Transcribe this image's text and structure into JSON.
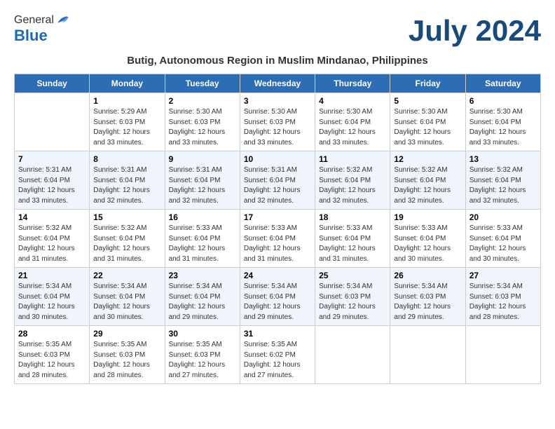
{
  "header": {
    "logo_general": "General",
    "logo_blue": "Blue",
    "month_title": "July 2024",
    "subtitle": "Butig, Autonomous Region in Muslim Mindanao, Philippines"
  },
  "calendar": {
    "weekdays": [
      "Sunday",
      "Monday",
      "Tuesday",
      "Wednesday",
      "Thursday",
      "Friday",
      "Saturday"
    ],
    "weeks": [
      [
        {
          "day": "",
          "info": ""
        },
        {
          "day": "1",
          "info": "Sunrise: 5:29 AM\nSunset: 6:03 PM\nDaylight: 12 hours\nand 33 minutes."
        },
        {
          "day": "2",
          "info": "Sunrise: 5:30 AM\nSunset: 6:03 PM\nDaylight: 12 hours\nand 33 minutes."
        },
        {
          "day": "3",
          "info": "Sunrise: 5:30 AM\nSunset: 6:03 PM\nDaylight: 12 hours\nand 33 minutes."
        },
        {
          "day": "4",
          "info": "Sunrise: 5:30 AM\nSunset: 6:04 PM\nDaylight: 12 hours\nand 33 minutes."
        },
        {
          "day": "5",
          "info": "Sunrise: 5:30 AM\nSunset: 6:04 PM\nDaylight: 12 hours\nand 33 minutes."
        },
        {
          "day": "6",
          "info": "Sunrise: 5:30 AM\nSunset: 6:04 PM\nDaylight: 12 hours\nand 33 minutes."
        }
      ],
      [
        {
          "day": "7",
          "info": "Sunrise: 5:31 AM\nSunset: 6:04 PM\nDaylight: 12 hours\nand 33 minutes."
        },
        {
          "day": "8",
          "info": "Sunrise: 5:31 AM\nSunset: 6:04 PM\nDaylight: 12 hours\nand 32 minutes."
        },
        {
          "day": "9",
          "info": "Sunrise: 5:31 AM\nSunset: 6:04 PM\nDaylight: 12 hours\nand 32 minutes."
        },
        {
          "day": "10",
          "info": "Sunrise: 5:31 AM\nSunset: 6:04 PM\nDaylight: 12 hours\nand 32 minutes."
        },
        {
          "day": "11",
          "info": "Sunrise: 5:32 AM\nSunset: 6:04 PM\nDaylight: 12 hours\nand 32 minutes."
        },
        {
          "day": "12",
          "info": "Sunrise: 5:32 AM\nSunset: 6:04 PM\nDaylight: 12 hours\nand 32 minutes."
        },
        {
          "day": "13",
          "info": "Sunrise: 5:32 AM\nSunset: 6:04 PM\nDaylight: 12 hours\nand 32 minutes."
        }
      ],
      [
        {
          "day": "14",
          "info": "Sunrise: 5:32 AM\nSunset: 6:04 PM\nDaylight: 12 hours\nand 31 minutes."
        },
        {
          "day": "15",
          "info": "Sunrise: 5:32 AM\nSunset: 6:04 PM\nDaylight: 12 hours\nand 31 minutes."
        },
        {
          "day": "16",
          "info": "Sunrise: 5:33 AM\nSunset: 6:04 PM\nDaylight: 12 hours\nand 31 minutes."
        },
        {
          "day": "17",
          "info": "Sunrise: 5:33 AM\nSunset: 6:04 PM\nDaylight: 12 hours\nand 31 minutes."
        },
        {
          "day": "18",
          "info": "Sunrise: 5:33 AM\nSunset: 6:04 PM\nDaylight: 12 hours\nand 31 minutes."
        },
        {
          "day": "19",
          "info": "Sunrise: 5:33 AM\nSunset: 6:04 PM\nDaylight: 12 hours\nand 30 minutes."
        },
        {
          "day": "20",
          "info": "Sunrise: 5:33 AM\nSunset: 6:04 PM\nDaylight: 12 hours\nand 30 minutes."
        }
      ],
      [
        {
          "day": "21",
          "info": "Sunrise: 5:34 AM\nSunset: 6:04 PM\nDaylight: 12 hours\nand 30 minutes."
        },
        {
          "day": "22",
          "info": "Sunrise: 5:34 AM\nSunset: 6:04 PM\nDaylight: 12 hours\nand 30 minutes."
        },
        {
          "day": "23",
          "info": "Sunrise: 5:34 AM\nSunset: 6:04 PM\nDaylight: 12 hours\nand 29 minutes."
        },
        {
          "day": "24",
          "info": "Sunrise: 5:34 AM\nSunset: 6:04 PM\nDaylight: 12 hours\nand 29 minutes."
        },
        {
          "day": "25",
          "info": "Sunrise: 5:34 AM\nSunset: 6:03 PM\nDaylight: 12 hours\nand 29 minutes."
        },
        {
          "day": "26",
          "info": "Sunrise: 5:34 AM\nSunset: 6:03 PM\nDaylight: 12 hours\nand 29 minutes."
        },
        {
          "day": "27",
          "info": "Sunrise: 5:34 AM\nSunset: 6:03 PM\nDaylight: 12 hours\nand 28 minutes."
        }
      ],
      [
        {
          "day": "28",
          "info": "Sunrise: 5:35 AM\nSunset: 6:03 PM\nDaylight: 12 hours\nand 28 minutes."
        },
        {
          "day": "29",
          "info": "Sunrise: 5:35 AM\nSunset: 6:03 PM\nDaylight: 12 hours\nand 28 minutes."
        },
        {
          "day": "30",
          "info": "Sunrise: 5:35 AM\nSunset: 6:03 PM\nDaylight: 12 hours\nand 27 minutes."
        },
        {
          "day": "31",
          "info": "Sunrise: 5:35 AM\nSunset: 6:02 PM\nDaylight: 12 hours\nand 27 minutes."
        },
        {
          "day": "",
          "info": ""
        },
        {
          "day": "",
          "info": ""
        },
        {
          "day": "",
          "info": ""
        }
      ]
    ]
  }
}
